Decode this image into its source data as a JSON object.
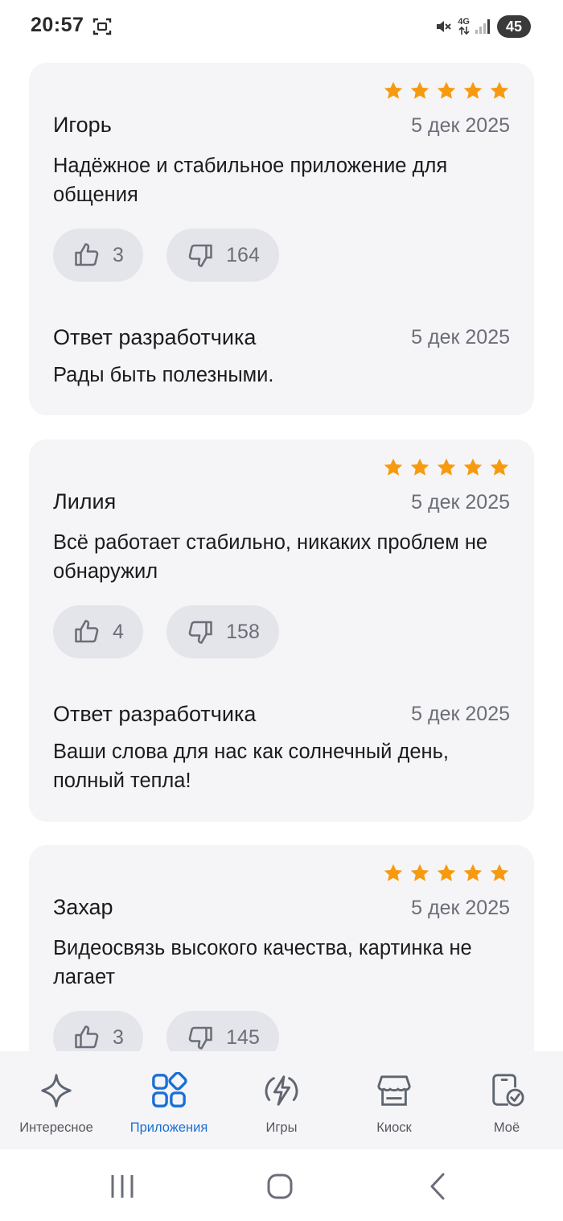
{
  "status_bar": {
    "time": "20:57",
    "network": "4G",
    "battery": "45"
  },
  "reviews": [
    {
      "author": "Игорь",
      "date": "5 дек 2025",
      "rating": 5,
      "text": "Надёжное и стабильное приложение для общения",
      "likes": "3",
      "dislikes": "164",
      "developer_reply": {
        "title": "Ответ разработчика",
        "date": "5 дек 2025",
        "text": "Рады быть полезными."
      }
    },
    {
      "author": "Лилия",
      "date": "5 дек 2025",
      "rating": 5,
      "text": "Всё работает стабильно, никаких проблем не обнаружил",
      "likes": "4",
      "dislikes": "158",
      "developer_reply": {
        "title": "Ответ разработчика",
        "date": "5 дек 2025",
        "text": "Ваши слова для нас как солнечный день, полный тепла!"
      }
    },
    {
      "author": "Захар",
      "date": "5 дек 2025",
      "rating": 5,
      "text": "Видеосвязь высокого качества, картинка не лагает",
      "likes": "3",
      "dislikes": "145"
    }
  ],
  "bottom_nav": [
    {
      "label": "Интересное",
      "icon": "sparkle-icon",
      "active": false
    },
    {
      "label": "Приложения",
      "icon": "apps-grid-icon",
      "active": true
    },
    {
      "label": "Игры",
      "icon": "lightning-icon",
      "active": false
    },
    {
      "label": "Киоск",
      "icon": "kiosk-icon",
      "active": false
    },
    {
      "label": "Моё",
      "icon": "my-apps-icon",
      "active": false
    }
  ],
  "colors": {
    "star": "#f79a0f",
    "card_bg": "#f5f5f7",
    "vote_bg": "#e4e5ea",
    "accent": "#1a6fd6",
    "secondary_text": "#6b6e78"
  }
}
